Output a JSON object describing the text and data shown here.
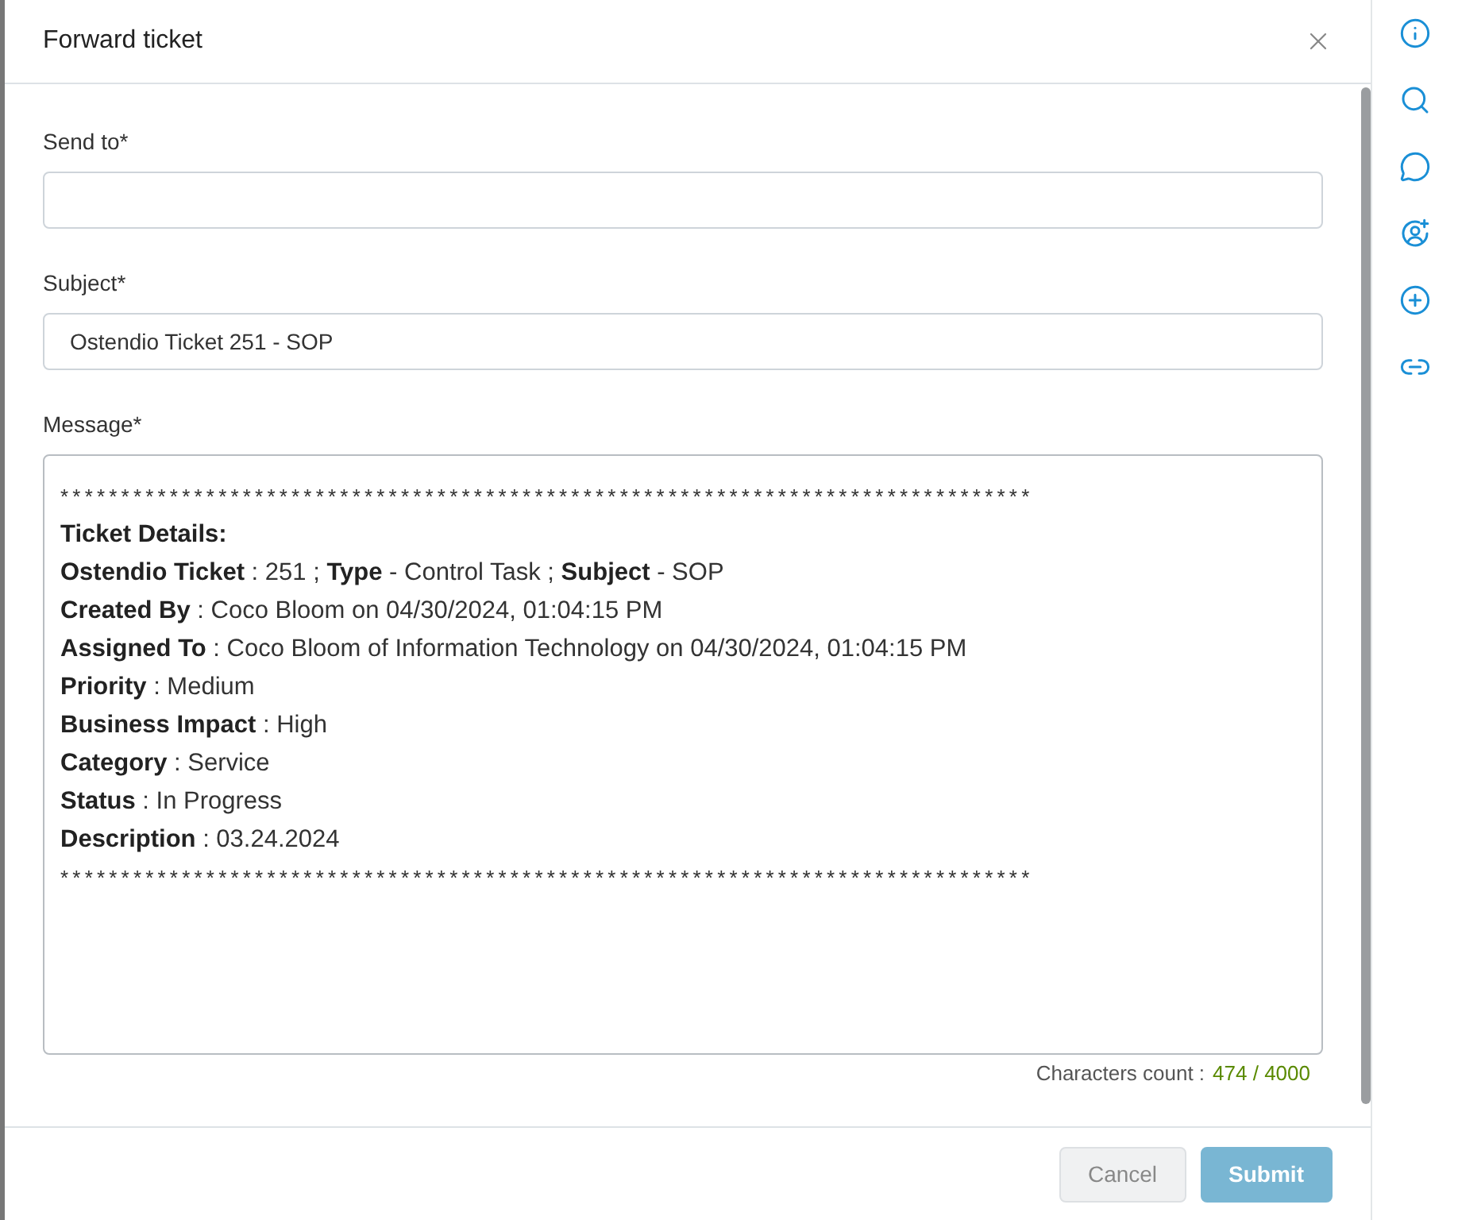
{
  "dialog": {
    "title": "Forward ticket"
  },
  "fields": [
    {
      "label": "Send to*"
    },
    {
      "label": "Subject*",
      "value": "Ostendio Ticket 251 - SOP"
    }
  ],
  "message": {
    "label": "Message*",
    "rule": "********************************************************************************",
    "lines": [
      "**Ticket Details:**",
      "**Ostendio Ticket** : 251 ; **Type** - Control Task ; **Subject** - SOP",
      "**Created By** : Coco Bloom on 04/30/2024, 01:04:15 PM",
      "**Assigned To** : Coco Bloom of Information Technology on 04/30/2024, 01:04:15 PM",
      "**Priority** : Medium",
      "**Business Impact** : High",
      "**Category** : Service",
      "**Status** : In Progress",
      "**Description** : 03.24.2024"
    ],
    "rule_end": "********************************************************************************",
    "count_label": "Characters count :",
    "count": "474 / 4000"
  },
  "buttons": [
    {
      "label": "Cancel",
      "kind": "secondary"
    },
    {
      "label": "Submit",
      "kind": "primary"
    }
  ],
  "sidebar": [
    {
      "kind": "info"
    },
    {
      "kind": "search"
    },
    {
      "kind": "comment"
    },
    {
      "kind": "user-add"
    },
    {
      "kind": "add"
    },
    {
      "kind": "link"
    }
  ]
}
